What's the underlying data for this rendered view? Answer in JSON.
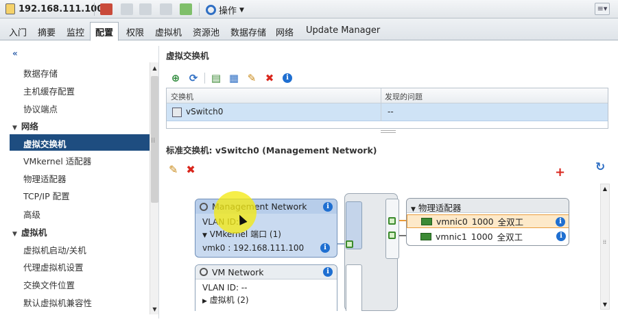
{
  "toolbar": {
    "host": "192.168.111.100",
    "actions_label": "操作"
  },
  "tabs": [
    "入门",
    "摘要",
    "监控",
    "配置",
    "权限",
    "虚拟机",
    "资源池",
    "数据存储",
    "网络",
    "Update Manager"
  ],
  "active_tab": "配置",
  "sidebar": {
    "collapse_glyph": "«",
    "items": [
      {
        "label": "数据存储",
        "type": "item"
      },
      {
        "label": "主机缓存配置",
        "type": "item"
      },
      {
        "label": "协议端点",
        "type": "item"
      },
      {
        "label": "网络",
        "type": "group"
      },
      {
        "label": "虚拟交换机",
        "type": "item",
        "selected": true
      },
      {
        "label": "VMkernel 适配器",
        "type": "item"
      },
      {
        "label": "物理适配器",
        "type": "item"
      },
      {
        "label": "TCP/IP 配置",
        "type": "item"
      },
      {
        "label": "高级",
        "type": "item"
      },
      {
        "label": "虚拟机",
        "type": "group"
      },
      {
        "label": "虚拟机启动/关机",
        "type": "item"
      },
      {
        "label": "代理虚拟机设置",
        "type": "item"
      },
      {
        "label": "交换文件位置",
        "type": "item"
      },
      {
        "label": "默认虚拟机兼容性",
        "type": "item"
      }
    ]
  },
  "vswitch": {
    "header": "虚拟交换机",
    "columns": [
      "交换机",
      "发现的问题"
    ],
    "rows": [
      {
        "name": "vSwitch0",
        "issues": "--"
      }
    ]
  },
  "standard_switch": {
    "header": "标准交换机: vSwitch0 (Management Network)",
    "portgroups": [
      {
        "name": "Management Network",
        "vlan": "VLAN ID: --",
        "ports": "VMkernel 端口 (1)",
        "vmk": "vmk0 : 192.168.111.100"
      },
      {
        "name": "VM Network",
        "vlan": "VLAN ID: --",
        "ports": "虚拟机 (2)"
      }
    ],
    "physical_adapters": {
      "title": "物理适配器",
      "nics": [
        {
          "name": "vmnic0",
          "speed": "1000",
          "duplex": "全双工"
        },
        {
          "name": "vmnic1",
          "speed": "1000",
          "duplex": "全双工"
        }
      ]
    }
  },
  "colors": {
    "selected_nav": "#1e4d80",
    "selected_row": "#cfe3f6",
    "highlight_nic": "#fde9c9",
    "accent_line": "#e99b3a"
  }
}
